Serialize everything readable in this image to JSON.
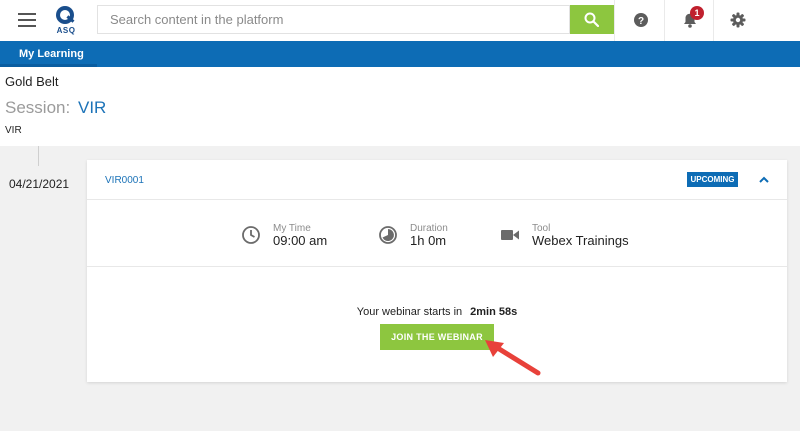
{
  "app": {
    "logo_text": "ASQ",
    "brand_color": "#0d6cb5",
    "accent_color": "#8dc63f"
  },
  "topbar": {
    "search_placeholder": "Search content in the platform",
    "notification_count": "1",
    "icons": [
      "menu-icon",
      "search-icon",
      "help-icon",
      "bell-icon",
      "gear-icon"
    ]
  },
  "nav": {
    "items": [
      {
        "label": "My Learning"
      }
    ]
  },
  "header": {
    "program": "Gold Belt",
    "session_label": "Session:",
    "session_value": "VIR",
    "session_sub": "VIR"
  },
  "timeline": {
    "date": "04/21/2021"
  },
  "card": {
    "code": "VIR0001",
    "status": "UPCOMING",
    "details": [
      {
        "label": "My Time",
        "value": "09:00 am",
        "icon": "clock-icon"
      },
      {
        "label": "Duration",
        "value": "1h 0m",
        "icon": "duration-icon"
      },
      {
        "label": "Tool",
        "value": "Webex Trainings",
        "icon": "video-camera-icon"
      }
    ],
    "countdown_text": "Your webinar starts in",
    "countdown_value": "2min 58s",
    "join_label": "JOIN THE WEBINAR"
  }
}
